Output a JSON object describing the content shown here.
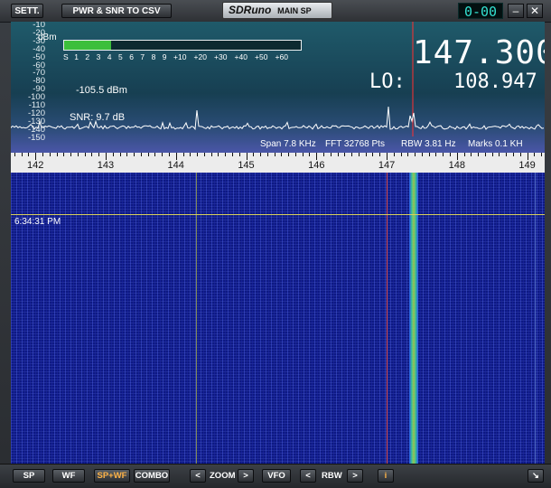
{
  "titlebar": {
    "sett_label": "SETT.",
    "csv_label": "PWR & SNR TO CSV",
    "brand": "SDRuno",
    "window_name": "MAIN SP",
    "clock": "0-00",
    "minimize_label": "–",
    "close_label": "✕"
  },
  "spectrum": {
    "db_unit": "dBm",
    "db_scale": [
      "-10",
      "-20",
      "-30",
      "-40",
      "-50",
      "-60",
      "-70",
      "-80",
      "-90",
      "-100",
      "-110",
      "-120",
      "-130",
      "-140",
      "-150"
    ],
    "smeter_labels": [
      "S",
      "1",
      "2",
      "3",
      "4",
      "5",
      "6",
      "7",
      "8",
      "9",
      "+10",
      "+20",
      "+30",
      "+40",
      "+50",
      "+60"
    ],
    "smeter_level": 0.2,
    "power_readout": "-105.5 dBm",
    "snr_readout": "SNR: 9.7 dB",
    "vfo_frequency": "147.300",
    "lo_label": "LO:",
    "lo_frequency": "108.947",
    "span": "Span 7.8 KHz",
    "fft": "FFT 32768 Pts",
    "rbw": "RBW 3.81 Hz",
    "marks": "Marks 0.1 KH"
  },
  "axis": {
    "ticks": [
      "142",
      "143",
      "144",
      "145",
      "146",
      "147",
      "148",
      "149"
    ]
  },
  "waterfall": {
    "timestamp": "6:34:31 PM"
  },
  "bottombar": {
    "sp": "SP",
    "wf": "WF",
    "spwf": "SP+WF",
    "combo": "COMBO",
    "zoom_left": "<",
    "zoom_label": "ZOOM",
    "zoom_right": ">",
    "vfo": "VFO",
    "rbw_left": "<",
    "rbw_label": "RBW",
    "rbw_right": ">",
    "info": "i",
    "resize": "↘"
  },
  "colors": {
    "spwf_active": "#ffb347",
    "smeter_fill": "#3cbf3c",
    "vfo_marker": "#ff3030",
    "signal_green": "#44e08a"
  }
}
